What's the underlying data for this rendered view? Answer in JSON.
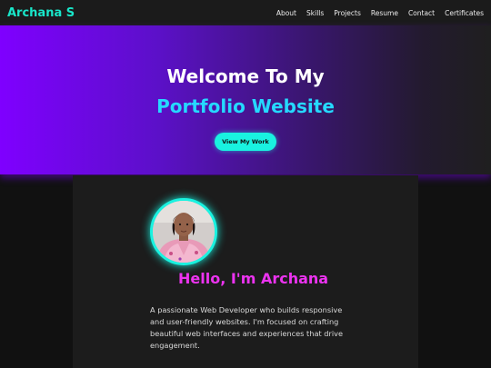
{
  "navbar": {
    "brand": "Archana S",
    "links": [
      "About",
      "Skills",
      "Projects",
      "Resume",
      "Contact",
      "Certificates"
    ]
  },
  "hero": {
    "title": "Welcome To My",
    "subtitle": "Portfolio Website",
    "button_label": "View My Work"
  },
  "about": {
    "heading": "Hello, I'm Archana",
    "text": "A passionate Web Developer who builds responsive and user-friendly websites. I'm focused on crafting beautiful web interfaces and experiences that drive engagement."
  },
  "colors": {
    "accent_teal": "#19f2e0",
    "accent_cyan": "#25d9ff",
    "accent_magenta": "#ec33f0",
    "hero_purple": "#7f00ff",
    "background": "#111111"
  }
}
